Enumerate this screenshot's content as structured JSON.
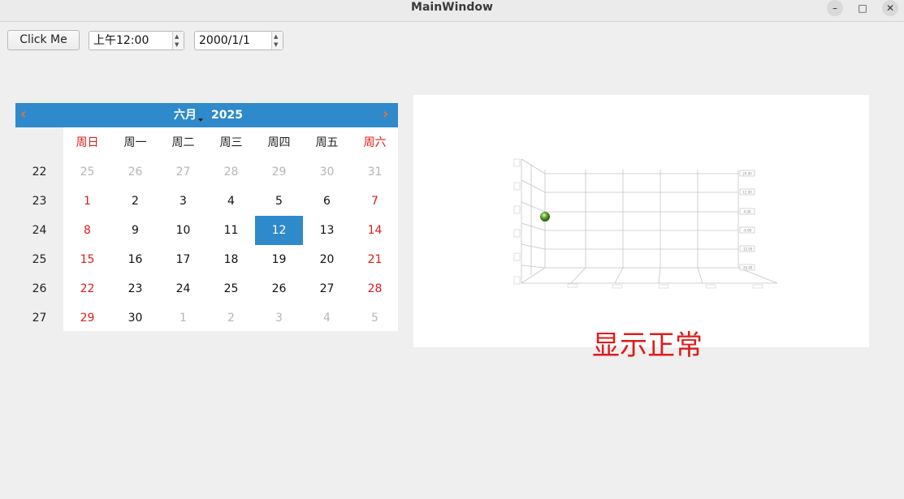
{
  "window": {
    "title": "MainWindow",
    "minimize_glyph": "–",
    "maximize_glyph": "□",
    "close_glyph": "✕"
  },
  "toolbar": {
    "click_label": "Click Me",
    "time_value": "上午12:00",
    "date_value": "2000/1/1"
  },
  "calendar": {
    "month": "六月",
    "year": "2025",
    "prev_glyph": "‹",
    "next_glyph": "›",
    "weekday_headers": [
      "周日",
      "周一",
      "周二",
      "周三",
      "周四",
      "周五",
      "周六"
    ],
    "week_numbers": [
      "22",
      "23",
      "24",
      "25",
      "26",
      "27"
    ],
    "days": [
      [
        "25",
        "26",
        "27",
        "28",
        "29",
        "30",
        "31"
      ],
      [
        "1",
        "2",
        "3",
        "4",
        "5",
        "6",
        "7"
      ],
      [
        "8",
        "9",
        "10",
        "11",
        "12",
        "13",
        "14"
      ],
      [
        "15",
        "16",
        "17",
        "18",
        "19",
        "20",
        "21"
      ],
      [
        "22",
        "23",
        "24",
        "25",
        "26",
        "27",
        "28"
      ],
      [
        "29",
        "30",
        "1",
        "2",
        "3",
        "4",
        "5"
      ]
    ],
    "selected_day": "12",
    "colors": {
      "header_bg": "#2e8acb",
      "nav_arrow": "#e8742b",
      "weekend": "#e01b1b",
      "other_month": "#b6b6b6"
    }
  },
  "chart": {
    "axis_labels": [
      "20.00",
      "12.00",
      "4.00",
      "-4.00",
      "-12.00",
      "-20.00"
    ],
    "point_color": "#5aa02c"
  },
  "status_label": "显示正常",
  "icons": {
    "prev": "chevron-left-icon",
    "next": "chevron-right-icon",
    "spin_up": "triangle-up-icon",
    "spin_down": "triangle-down-icon"
  }
}
